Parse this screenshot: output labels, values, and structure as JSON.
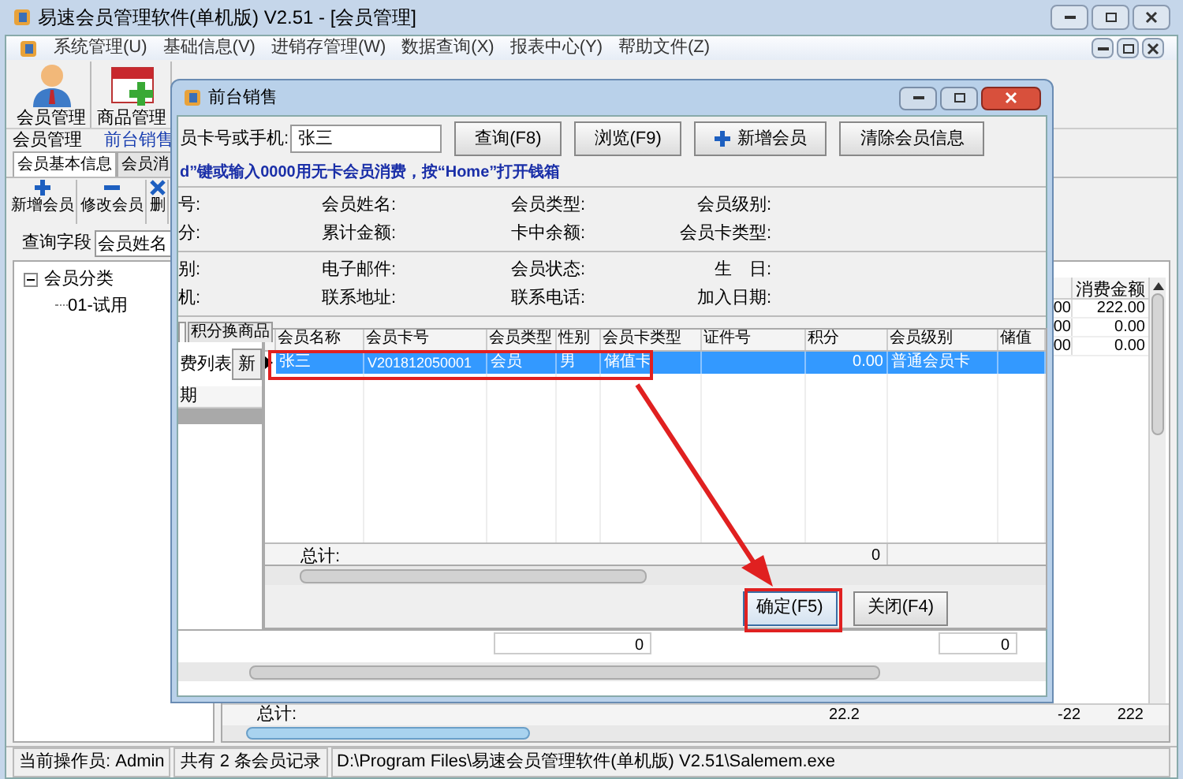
{
  "window": {
    "title": "易速会员管理软件(单机版) V2.51 - [会员管理]"
  },
  "menu": [
    "系统管理(U)",
    "基础信息(V)",
    "进销存管理(W)",
    "数据查询(X)",
    "报表中心(Y)",
    "帮助文件(Z)"
  ],
  "toolbar": [
    {
      "label": "会员管理",
      "kind": "person"
    },
    {
      "label": "商品管理",
      "kind": "calendar"
    }
  ],
  "doc_tabs": [
    {
      "label": "会员管理",
      "selected": false
    },
    {
      "label": "前台销售",
      "selected": true
    }
  ],
  "sub_tabs": [
    {
      "label": "会员基本信息",
      "selected": true
    },
    {
      "label": "会员消",
      "selected": false
    }
  ],
  "actions": [
    {
      "label": "新增会员",
      "kind": "add"
    },
    {
      "label": "修改会员",
      "kind": "edit"
    },
    {
      "label": "删",
      "kind": "delete"
    }
  ],
  "query": {
    "label": "查询字段",
    "value": "会员姓名"
  },
  "tree": [
    {
      "label": "会员分类",
      "expanded": true,
      "children": [
        {
          "label": "01-试用"
        }
      ]
    }
  ],
  "background_table": {
    "columns": [
      "",
      "消费金额"
    ],
    "rows": [
      [
        "00",
        "222.00"
      ],
      [
        "00",
        "0.00"
      ],
      [
        "00",
        "0.00"
      ]
    ],
    "totals": {
      "label": "总计:",
      "values": [
        "22.2",
        "-22",
        "222"
      ]
    }
  },
  "status_bar": [
    "当前操作员: Admin",
    "共有 2 条会员记录",
    "D:\\Program Files\\易速会员管理软件(单机版) V2.51\\Salemem.exe"
  ],
  "dialog": {
    "title": "前台销售",
    "search": {
      "label": "员卡号或手机:",
      "value": "张三"
    },
    "buttons": [
      {
        "label": "查询(F8)",
        "kind": "plain"
      },
      {
        "label": "浏览(F9)",
        "kind": "plain"
      },
      {
        "label": "新增会员",
        "kind": "add"
      },
      {
        "label": "清除会员信息",
        "kind": "plain"
      }
    ],
    "hint": "d”键或输入0000用无卡会员消费，按“Home”打开钱箱",
    "info_groups": [
      [
        [
          "号:",
          "会员姓名:",
          "会员类型:",
          "会员级别:"
        ],
        [
          "分:",
          "累计金额:",
          "卡中余额:",
          "会员卡类型:"
        ]
      ],
      [
        [
          "别:",
          "电子邮件:",
          "会员状态:",
          "生　日:"
        ],
        [
          "机:",
          "联系地址:",
          "联系电话:",
          "加入日期:"
        ]
      ]
    ],
    "tabs": [
      {
        "label": "积分换商品",
        "selected": false
      }
    ],
    "left_panel": {
      "label": "费列表",
      "button": "新",
      "header": "期"
    },
    "grid": {
      "columns": [
        "会员名称",
        "会员卡号",
        "会员类型",
        "性别",
        "会员卡类型",
        "证件号",
        "积分",
        "会员级别",
        "储值"
      ],
      "rows": [
        {
          "selected": true,
          "cells": [
            "张三",
            "V201812050001",
            "会员",
            "男",
            "储值卡",
            null,
            "0.00",
            "普通会员卡",
            null
          ]
        }
      ],
      "total": {
        "label": "总计:",
        "value": "0"
      }
    },
    "footer_buttons": [
      {
        "label": "确定(F5)",
        "kind": "primary"
      },
      {
        "label": "关闭(F4)",
        "kind": "plain"
      }
    ],
    "lower_values": [
      "0",
      "0"
    ]
  }
}
